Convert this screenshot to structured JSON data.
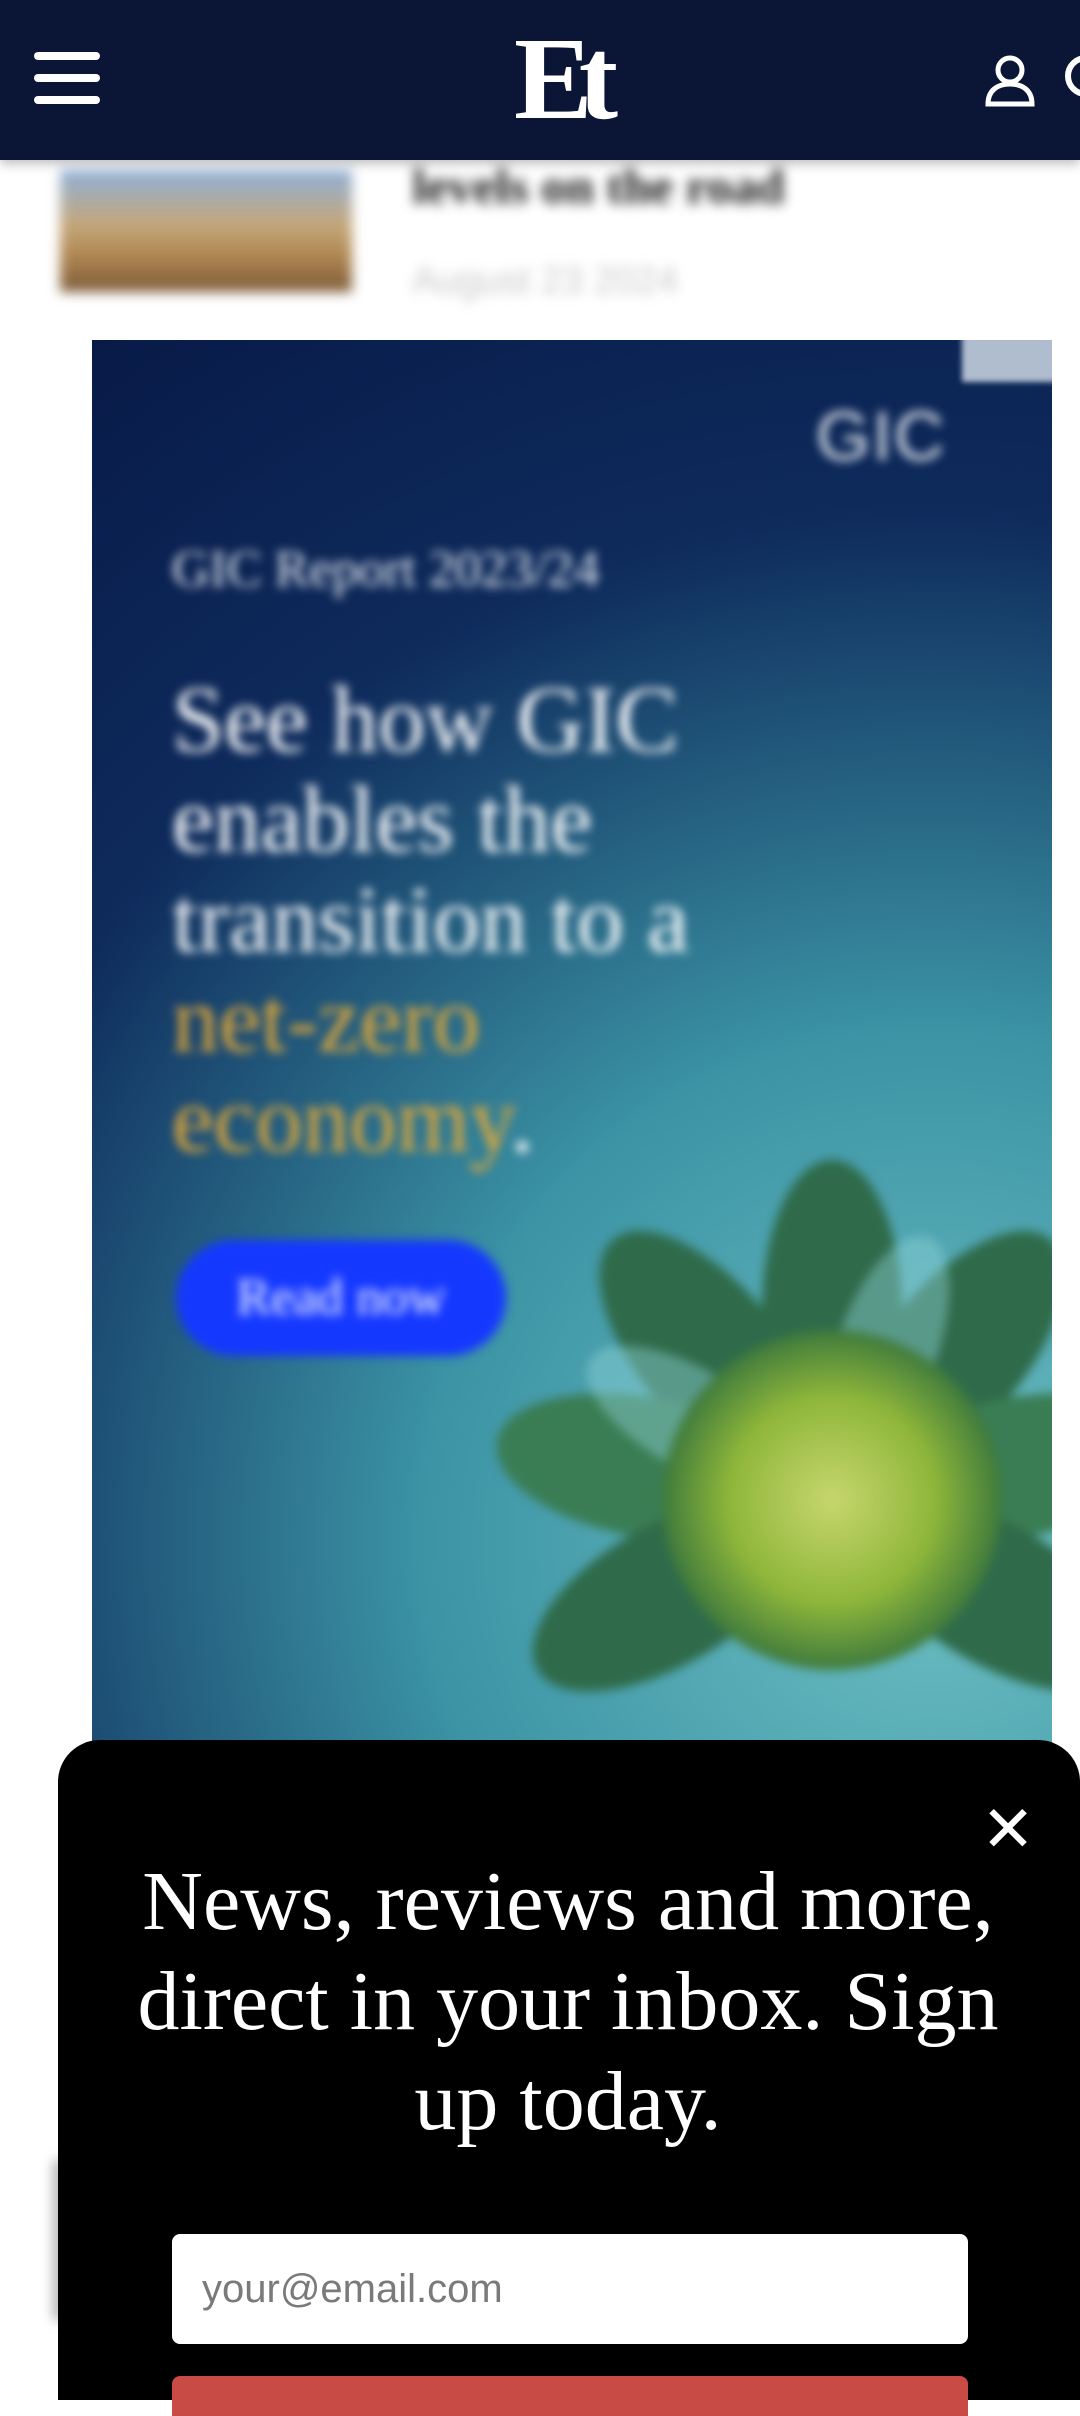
{
  "header": {
    "logo_text": "Et",
    "menu_icon": "hamburger-menu-icon",
    "account_icon": "user-icon",
    "search_icon": "search-icon"
  },
  "article": {
    "title": "levels on the road",
    "date": "August 23 2024"
  },
  "ad": {
    "brand": "GIC",
    "kicker": "GIC Report 2023/24",
    "headline_plain": "See how GIC enables the transition to a ",
    "headline_highlight": "net-zero economy",
    "headline_end": ".",
    "cta": "Read now",
    "highlight_color": "#e1a83a",
    "cta_color": "#1538ff"
  },
  "signup": {
    "title": "News, reviews and more, direct in your inbox. Sign up today.",
    "email_placeholder": "your@email.com",
    "close_icon": "close-icon",
    "submit_color": "#c94b45"
  },
  "colors": {
    "header_bg": "#0b1535",
    "sheet_bg": "#000000"
  }
}
